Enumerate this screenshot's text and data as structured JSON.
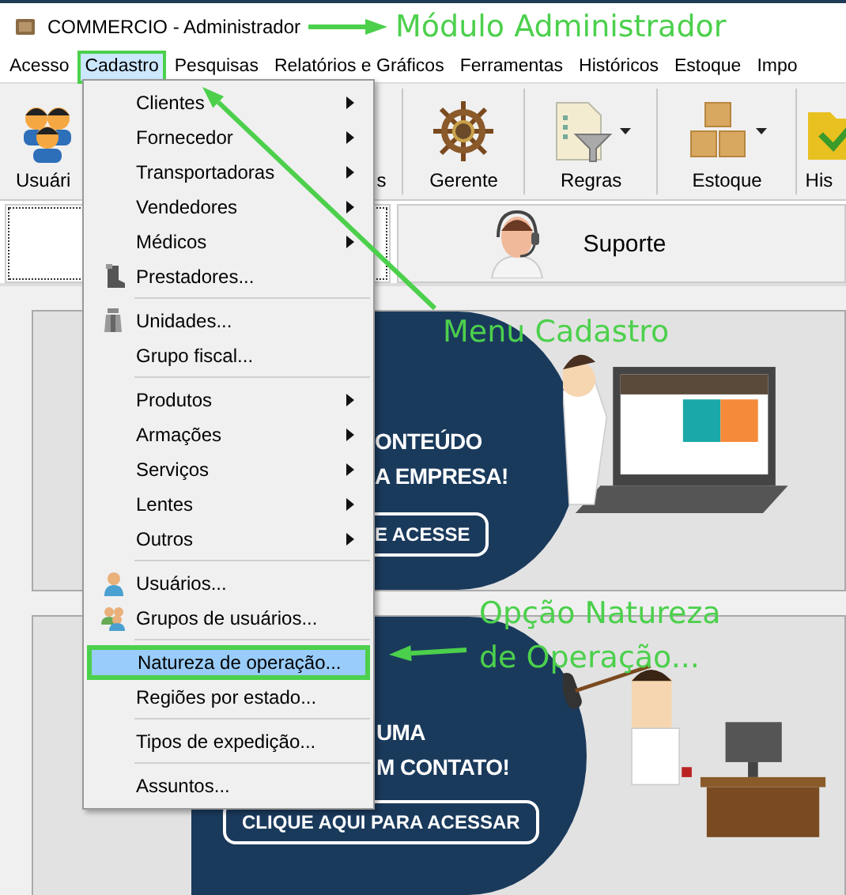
{
  "window": {
    "title": "COMMERCIO - Administrador"
  },
  "menu_bar": [
    {
      "label": "Acesso",
      "selected": false
    },
    {
      "label": "Cadastro",
      "selected": true
    },
    {
      "label": "Pesquisas",
      "selected": false
    },
    {
      "label": "Relatórios e Gráficos",
      "selected": false
    },
    {
      "label": "Ferramentas",
      "selected": false
    },
    {
      "label": "Históricos",
      "selected": false
    },
    {
      "label": "Estoque",
      "selected": false
    },
    {
      "label": "Impo",
      "selected": false
    }
  ],
  "toolbar": [
    {
      "label": "Usuári",
      "kind": "users",
      "dropdown": false
    },
    {
      "label": "s",
      "kind": "hidden",
      "dropdown": false
    },
    {
      "label": "Gerente",
      "kind": "wheel",
      "dropdown": false
    },
    {
      "label": "Regras",
      "kind": "filter",
      "dropdown": true
    },
    {
      "label": "Estoque",
      "kind": "boxes",
      "dropdown": true
    },
    {
      "label": "His",
      "kind": "folder",
      "dropdown": false
    }
  ],
  "tabs": [
    {
      "selected": true
    },
    {
      "label": "Suporte",
      "selected": false
    }
  ],
  "dropdown_menu": [
    {
      "kind": "item",
      "label": "Clientes",
      "submenu": true,
      "selected": false
    },
    {
      "kind": "item",
      "label": "Fornecedor",
      "submenu": true,
      "selected": false
    },
    {
      "kind": "item",
      "label": "Transportadoras",
      "submenu": true,
      "selected": false
    },
    {
      "kind": "item",
      "label": "Vendedores",
      "submenu": true,
      "selected": false
    },
    {
      "kind": "item",
      "label": "Médicos",
      "submenu": true,
      "selected": false
    },
    {
      "kind": "item",
      "label": "Prestadores...",
      "submenu": false,
      "selected": false
    },
    {
      "kind": "separator"
    },
    {
      "kind": "item",
      "label": "Unidades...",
      "submenu": false,
      "selected": false
    },
    {
      "kind": "item",
      "label": "Grupo fiscal...",
      "submenu": false,
      "selected": false
    },
    {
      "kind": "separator"
    },
    {
      "kind": "item",
      "label": "Produtos",
      "submenu": true,
      "selected": false
    },
    {
      "kind": "item",
      "label": "Armações",
      "submenu": true,
      "selected": false
    },
    {
      "kind": "item",
      "label": "Serviços",
      "submenu": true,
      "selected": false
    },
    {
      "kind": "item",
      "label": "Lentes",
      "submenu": true,
      "selected": false
    },
    {
      "kind": "item",
      "label": "Outros",
      "submenu": true,
      "selected": false
    },
    {
      "kind": "separator"
    },
    {
      "kind": "item",
      "label": "Usuários...",
      "submenu": false,
      "selected": false
    },
    {
      "kind": "item",
      "label": "Grupos de usuários...",
      "submenu": false,
      "selected": false
    },
    {
      "kind": "separator"
    },
    {
      "kind": "item",
      "label": "Natureza de operação...",
      "submenu": false,
      "selected": true
    },
    {
      "kind": "item",
      "label": "Regiões por estado...",
      "submenu": false,
      "selected": false
    },
    {
      "kind": "separator"
    },
    {
      "kind": "item",
      "label": "Tipos de expedição...",
      "submenu": false,
      "selected": false
    },
    {
      "kind": "separator"
    },
    {
      "kind": "item",
      "label": "Assuntos...",
      "submenu": false,
      "selected": false
    }
  ],
  "banners": [
    {
      "kind": "laptop",
      "lines": [
        "ONTEÚDO",
        "A EMPRESA!"
      ],
      "button": "E ACESSE"
    },
    {
      "kind": "desk",
      "lines": [
        "UMA",
        "M CONTATO!"
      ],
      "button": "CLIQUE AQUI PARA ACESSAR"
    }
  ],
  "annotations": [
    {
      "text": "Módulo Administrador"
    },
    {
      "text": "Menu Cadastro"
    },
    {
      "text": "Opção Natureza de Operação..."
    }
  ]
}
